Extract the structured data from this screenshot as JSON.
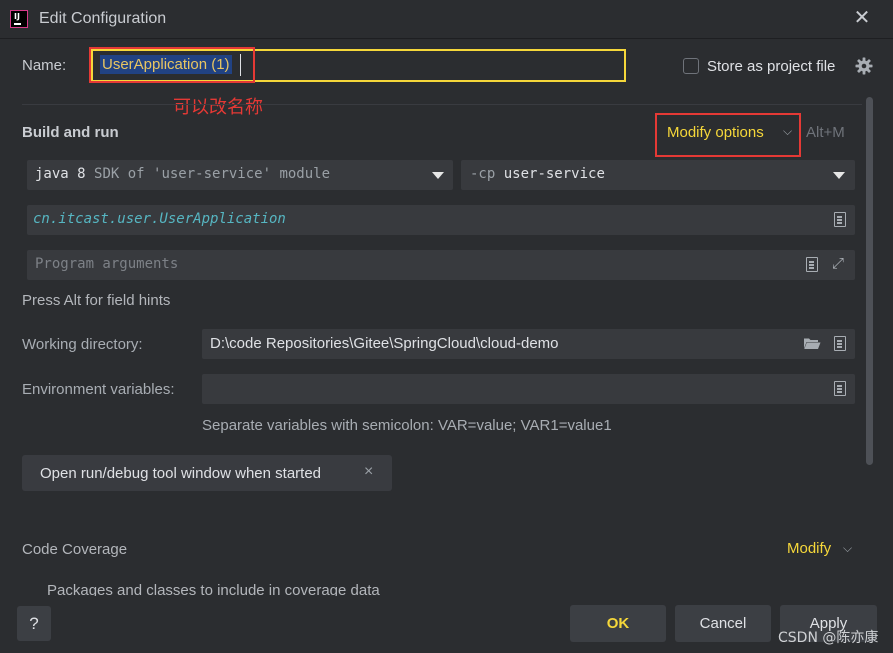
{
  "window": {
    "title": "Edit Configuration",
    "app_icon_text": "IJ"
  },
  "name": {
    "label": "Name:",
    "value": "UserApplication (1)",
    "annotation": "可以改名称"
  },
  "store_as_project_file": {
    "label": "Store as project file",
    "checked": false
  },
  "build_and_run": {
    "title": "Build and run",
    "modify_options_label": "Modify options",
    "modify_shortcut": "Alt+M",
    "sdk": {
      "java": "java 8",
      "rest": "SDK of 'user-service' module"
    },
    "classpath": {
      "flag": "-cp",
      "module": "user-service"
    },
    "main_class": "cn.itcast.user.UserApplication",
    "program_args_placeholder": "Program arguments",
    "hint": "Press Alt for field hints"
  },
  "working_directory": {
    "label": "Working directory:",
    "value": "D:\\code Repositories\\Gitee\\SpringCloud\\cloud-demo"
  },
  "environment_variables": {
    "label": "Environment variables:",
    "value": "",
    "hint": "Separate variables with semicolon: VAR=value; VAR1=value1"
  },
  "option_chip": {
    "label": "Open run/debug tool window when started",
    "close": "×"
  },
  "code_coverage": {
    "title": "Code Coverage",
    "modify_label": "Modify",
    "subtitle": "Packages and classes to include in coverage data"
  },
  "footer": {
    "help": "?",
    "ok": "OK",
    "cancel": "Cancel",
    "apply": "Apply"
  },
  "watermark": "CSDN @陈亦康",
  "colors": {
    "accent_yellow": "#f5d73a",
    "annotation_red": "#e53935",
    "background": "#2b2d30",
    "field": "#383a3e"
  }
}
